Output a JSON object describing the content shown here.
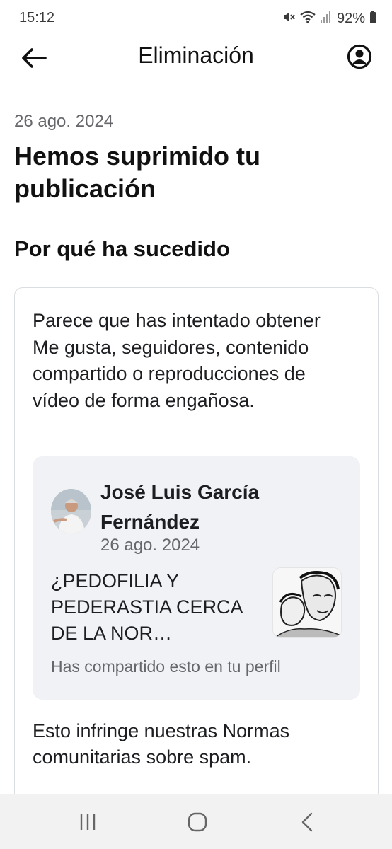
{
  "status_bar": {
    "time": "15:12",
    "battery": "92%",
    "icons": [
      "mute-icon",
      "wifi-icon",
      "signal-icon",
      "battery-icon"
    ]
  },
  "app_bar": {
    "title": "Eliminación",
    "back_icon": "arrow-left-icon",
    "profile_icon": "profile-icon"
  },
  "main": {
    "date": "26 ago. 2024",
    "headline": "Hemos suprimido tu publicación",
    "section_title": "Por qué ha sucedido",
    "card": {
      "reason_text": "Parece que has intentado obtener Me gusta, seguidores, contenido compartido o reproducciones de vídeo de forma engañosa.",
      "post": {
        "author": "José Luis García Fernández",
        "date": "26 ago. 2024",
        "text": "¿PEDOFILIA Y PEDERASTIA CERCA DE LA NOR…",
        "footer": "Has compartido esto en tu perfil"
      },
      "policy_text": "Esto infringe nuestras Normas comunitarias sobre spam."
    }
  },
  "nav_bar": {
    "icons": [
      "recent-apps-icon",
      "home-icon",
      "back-icon"
    ]
  },
  "colors": {
    "text_primary": "#1c1e21",
    "text_secondary": "#65676b",
    "post_background": "#f0f2f5",
    "card_border": "#dadde1"
  }
}
